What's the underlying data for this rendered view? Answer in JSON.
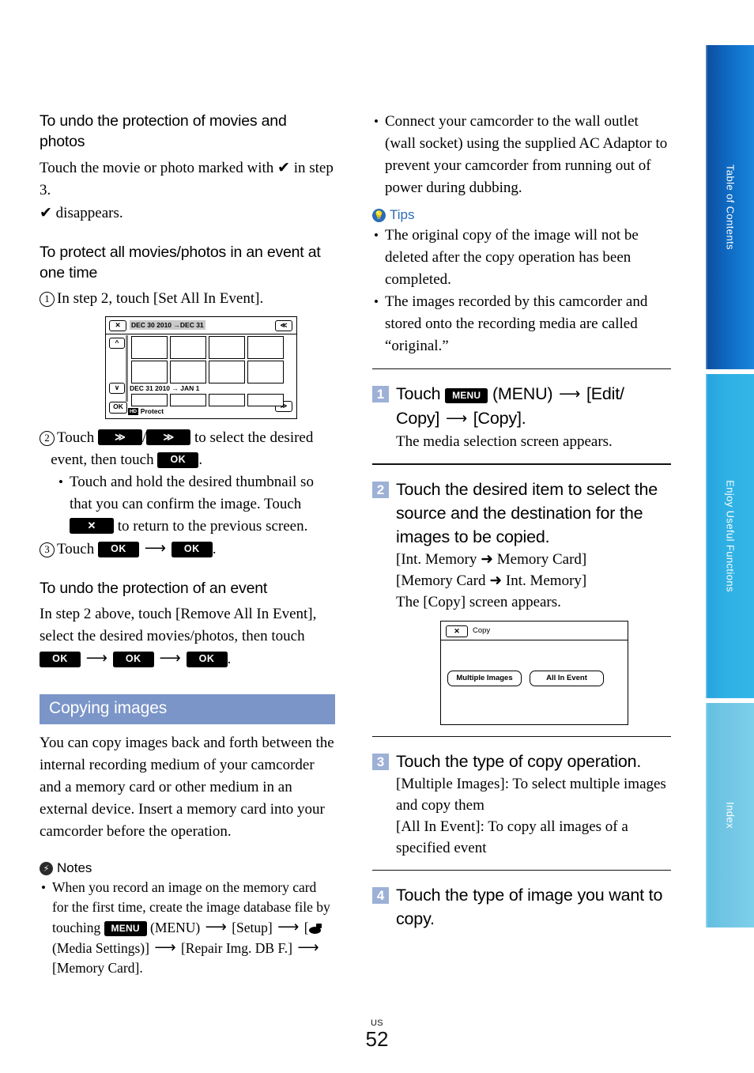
{
  "document": {
    "page_number": "52",
    "region_code": "US"
  },
  "left_column": {
    "heading_1": "To undo the protection of movies and photos",
    "para_1_before": "Touch the movie or photo marked with",
    "para_1_after": "in step 3.",
    "para_1_line3": "disappears.",
    "check_glyph": "✔",
    "heading_2": "To protect all movies/photos in an event at one time",
    "step_1": "In step 2, touch [Set All In Event].",
    "step_1_num": "1",
    "figure_1": {
      "close_button": "✕",
      "scroll_up_fast": "≪",
      "scroll_up": "^",
      "scroll_down": "∨",
      "scroll_down_fast": "≫",
      "ok_button": "OK",
      "date_label_top": "DEC 30 2010 →DEC 31",
      "date_label_bottom": "DEC 31 2010 → JAN 1",
      "footer_badge": "HD",
      "footer_label": "Protect"
    },
    "step_2_num": "2",
    "step_2_a": "Touch",
    "step_2_b": "to select the desired",
    "step_2_c": "event, then touch",
    "step_2_key_up": "≫",
    "step_2_key_down": "≫",
    "step_2_key_ok": "OK",
    "step_2_bullet_a": "Touch and hold the desired thumbnail so that you can confirm the image. Touch",
    "step_2_bullet_key": "✕",
    "step_2_bullet_b": "to return to the previous screen.",
    "step_3_num": "3",
    "step_3_a": "Touch",
    "step_3_key1": "OK",
    "step_3_key2": "OK",
    "heading_3": "To undo the protection of an event",
    "para_3_a": "In step 2 above, touch [Remove All In Event], select the desired movies/photos, then touch",
    "para_3_key1": "OK",
    "para_3_key2": "OK",
    "para_3_key3": "OK",
    "section_bar_title": "Copying images",
    "section_para": "You can copy images back and forth between the internal recording medium of your camcorder and a memory card or other medium in an external device. Insert a memory card into your camcorder before the operation.",
    "notes_label": "Notes",
    "notes_icon": "notes-lightning-icon",
    "note_1_a": "When you record an image on the memory card for the first time, create the image database file by touching",
    "note_1_menu_key": "MENU",
    "note_1_b": "(MENU)",
    "note_1_c": "[Setup]",
    "note_1_d": "[",
    "note_1_e": "(Media Settings)]",
    "note_1_f": "[Repair Img. DB F.]",
    "note_1_g": "[Memory Card]."
  },
  "right_column": {
    "bullet_top": "Connect your camcorder to the wall outlet (wall socket) using the supplied AC Adaptor to prevent your camcorder from running out of power during dubbing.",
    "tips_label": "Tips",
    "tips_icon": "tips-lightbulb-icon",
    "tip_1": "The original copy of the image will not be deleted after the copy operation has been completed.",
    "tip_2": "The images recorded by this camcorder and stored onto the recording media are called “original.”",
    "steps": [
      {
        "num": "1",
        "title_a": "Touch",
        "menu_key": "MENU",
        "title_b": "(MENU)",
        "title_c": "[Edit/ Copy]",
        "title_d": "[Copy].",
        "body": "The media selection screen appears."
      },
      {
        "num": "2",
        "title": "Touch the desired item to select the source and the destination for the images to be copied.",
        "body_line1": "[Int. Memory ➜ Memory Card]",
        "body_line2": "[Memory Card ➜ Int. Memory]",
        "body_line3": "The [Copy] screen appears."
      },
      {
        "num": "3",
        "title": "Touch the type of copy operation.",
        "body_line1": "[Multiple Images]: To select multiple images and copy them",
        "body_line2": "[All In Event]: To copy all images of a specified event"
      },
      {
        "num": "4",
        "title": "Touch the type of image you want to copy."
      }
    ],
    "figure_2": {
      "close_button": "✕",
      "title": "Copy",
      "option_left": "Multiple Images",
      "option_right": "All In Event"
    }
  },
  "side_tabs": [
    {
      "label": "Table of Contents",
      "color": "#0e63bb"
    },
    {
      "label": "Enjoy Useful Functions",
      "color": "#2fb0e4"
    },
    {
      "label": "Index",
      "color": "#72c6e4"
    }
  ]
}
